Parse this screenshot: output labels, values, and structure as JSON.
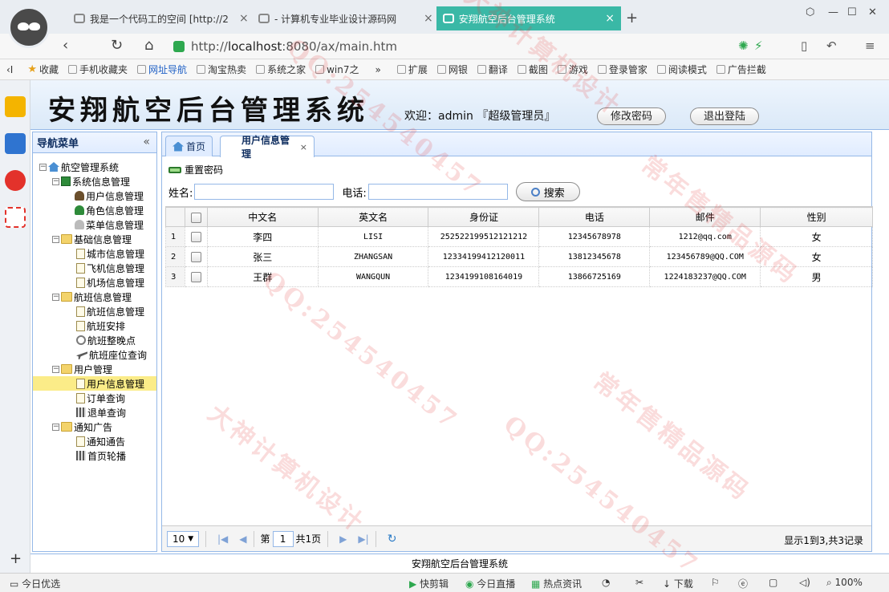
{
  "browser": {
    "tabs": [
      {
        "title": "我是一个代码工的空间 [http://2"
      },
      {
        "title": "- 计算机专业毕业设计源码网"
      },
      {
        "title": "安翔航空后台管理系统"
      }
    ],
    "url_prefix": "http://",
    "url_host": "localhost",
    "url_rest": ":8080/ax/main.htm",
    "bookmarks": [
      "收藏",
      "手机收藏夹",
      "网址导航",
      "淘宝热卖",
      "系统之家",
      "win7之",
      "扩展",
      "网银",
      "翻译",
      "截图",
      "游戏",
      "登录管家",
      "阅读模式",
      "广告拦截"
    ],
    "status": {
      "left": "今日优选",
      "items": [
        "快剪辑",
        "今日直播",
        "热点资讯",
        "下载"
      ],
      "zoom": "100%"
    }
  },
  "header": {
    "title": "安翔航空后台管理系统",
    "welcome": "欢迎：admin 『超级管理员』",
    "change_password": "修改密码",
    "logout": "退出登陆"
  },
  "nav": {
    "title": "导航菜单",
    "tree": {
      "root": "航空管理系统",
      "groups": [
        {
          "label": "系统信息管理",
          "items": [
            "用户信息管理",
            "角色信息管理",
            "菜单信息管理"
          ]
        },
        {
          "label": "基础信息管理",
          "items": [
            "城市信息管理",
            "飞机信息管理",
            "机场信息管理"
          ]
        },
        {
          "label": "航班信息管理",
          "items": [
            "航班信息管理",
            "航班安排",
            "航班整晚点",
            "航班座位查询"
          ]
        },
        {
          "label": "用户管理",
          "items": [
            "用户信息管理",
            "订单查询",
            "退单查询"
          ]
        },
        {
          "label": "通知广告",
          "items": [
            "通知通告",
            "首页轮播"
          ]
        }
      ]
    }
  },
  "content": {
    "tabs": [
      {
        "label": "首页"
      },
      {
        "label": "用户信息管理"
      }
    ],
    "toolbar": {
      "reset_password": "重置密码"
    },
    "search": {
      "name_label": "姓名:",
      "name_value": "",
      "phone_label": "电话:",
      "phone_value": "",
      "search_button": "搜索"
    },
    "table": {
      "columns": [
        "中文名",
        "英文名",
        "身份证",
        "电话",
        "邮件",
        "性别"
      ],
      "rows": [
        {
          "num": "1",
          "cn": "李四",
          "en": "LISI",
          "id": "252522199512121212",
          "phone": "12345678978",
          "email": "1212@qq.com",
          "gender": "女"
        },
        {
          "num": "2",
          "cn": "张三",
          "en": "ZHANGSAN",
          "id": "12334199412120011",
          "phone": "13812345678",
          "email": "123456789@QQ.COM",
          "gender": "女"
        },
        {
          "num": "3",
          "cn": "王群",
          "en": "WANGQUN",
          "id": "1234199108164019",
          "phone": "13866725169",
          "email": "1224183237@QQ.COM",
          "gender": "男"
        }
      ]
    },
    "pager": {
      "page_size": "10",
      "page_label": "第",
      "page_value": "1",
      "total_pages": "共1页",
      "info": "显示1到3,共3记录"
    }
  },
  "footer": {
    "text": "安翔航空后台管理系统"
  },
  "watermarks": [
    "QQ:254540457",
    "大神计算机设计",
    "常年售精品源码",
    "QQ:254540457",
    "大神计算机设计",
    "常年售精品源码",
    "QQ:254540457"
  ]
}
